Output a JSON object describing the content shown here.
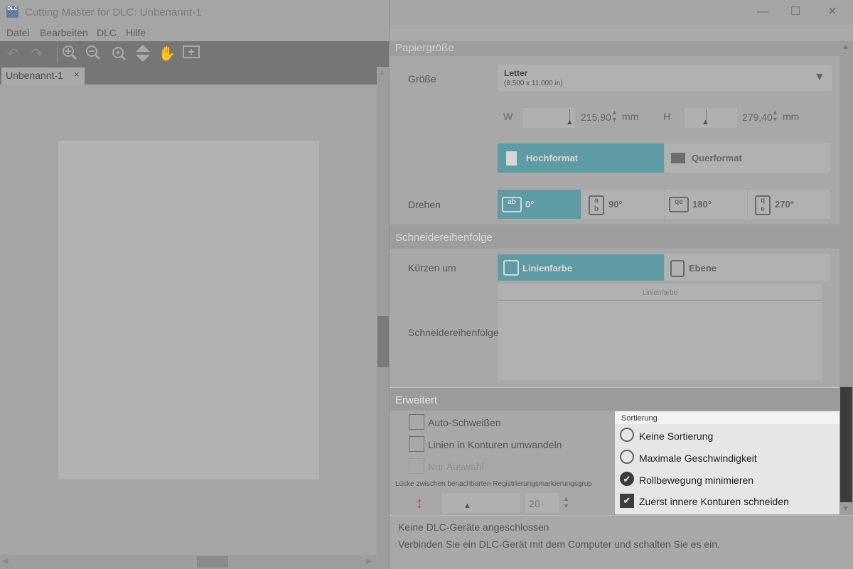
{
  "window": {
    "title": "Cutting Master for DLC: Unbenannt-1",
    "icon_text": "DLC"
  },
  "menu": [
    "Datei",
    "Bearbeiten",
    "DLC",
    "Hilfe"
  ],
  "toolbar": {
    "icons": [
      "undo-icon",
      "redo-icon",
      "zoom-in-icon",
      "zoom-out-icon",
      "zoom-fit-icon",
      "move-icon",
      "hand-icon",
      "select-area-icon"
    ]
  },
  "document_tab": {
    "label": "Unbenannt-1",
    "close": "×"
  },
  "paper_size": {
    "section_title": "Papiergröße",
    "size_label": "Größe",
    "selected_name": "Letter",
    "selected_dims": "(8.500 x 11,000 in)",
    "w_label": "W",
    "w_value": "215,90",
    "h_label": "H",
    "h_value": "279,40",
    "unit": "mm",
    "orientation": {
      "portrait": "Hochformat",
      "landscape": "Querformat",
      "selected": "Hochformat"
    },
    "rotate_label": "Drehen",
    "rotations": [
      "0°",
      "90°",
      "180°",
      "270°"
    ],
    "rotation_selected": "0°"
  },
  "cut_order": {
    "section_title": "Schneidereihenfolge",
    "shorten_label": "Kürzen um",
    "options": [
      "Linienfarbe",
      "Ebene"
    ],
    "selected": "Linienfarbe",
    "order_label": "Schneidereihenfolge",
    "table_header": "Linienfarbe"
  },
  "advanced": {
    "section_title": "Erweitert",
    "auto_weld": "Auto-Schweißen",
    "convert_lines": "Linien in Konturen umwandeln",
    "selection_only": "Nur Auswahl",
    "gap_label": "Lücke zwischen benachbarten Registrierungsmarkierungsgrup",
    "gap_value": "20"
  },
  "sort_popup": {
    "title": "Sortierung",
    "options": [
      {
        "label": "Keine Sortierung",
        "checked": false
      },
      {
        "label": "Maximale Geschwindigkeit",
        "checked": false
      },
      {
        "label": "Rollbewegung minimieren",
        "checked": true
      }
    ],
    "inner_first": {
      "label": "Zuerst innere Konturen schneiden",
      "checked": true
    }
  },
  "status": {
    "line1": "Keine DLC-Geräte angeschlossen",
    "line2": "Verbinden Sie ein DLC-Gerät mit dem Computer und schalten Sie es ein."
  },
  "colors": {
    "accent": "#5f9ba4",
    "popup_bg": "#e6e6e6",
    "overlay": "#a8a8a8"
  }
}
